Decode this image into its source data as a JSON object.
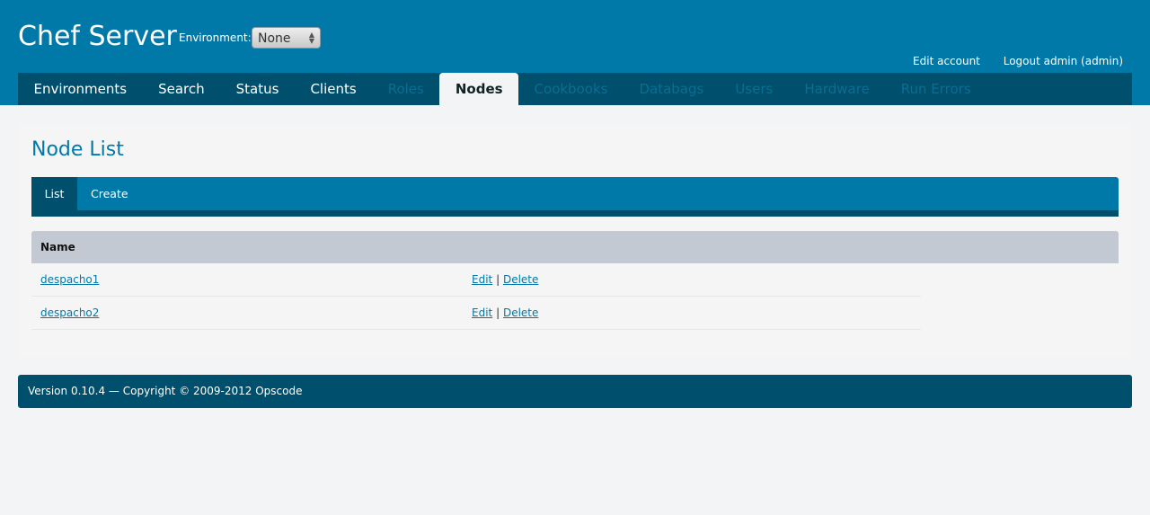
{
  "header": {
    "title": "Chef Server",
    "environment_label": "Environment:",
    "environment_value": "None",
    "edit_account": "Edit account",
    "logout": "Logout admin (admin)"
  },
  "nav": {
    "items": [
      {
        "label": "Environments",
        "state": "normal"
      },
      {
        "label": "Search",
        "state": "normal"
      },
      {
        "label": "Status",
        "state": "normal"
      },
      {
        "label": "Clients",
        "state": "normal"
      },
      {
        "label": "Roles",
        "state": "dim"
      },
      {
        "label": "Nodes",
        "state": "active"
      },
      {
        "label": "Cookbooks",
        "state": "dim"
      },
      {
        "label": "Databags",
        "state": "dim"
      },
      {
        "label": "Users",
        "state": "dim"
      },
      {
        "label": "Hardware",
        "state": "dim"
      },
      {
        "label": "Run Errors",
        "state": "dim"
      }
    ]
  },
  "main": {
    "page_title": "Node List",
    "tabs": [
      {
        "label": "List"
      },
      {
        "label": "Create"
      }
    ],
    "table": {
      "column_name": "Name",
      "rows": [
        {
          "name": "despacho1",
          "edit": "Edit",
          "separator": "|",
          "delete": "Delete"
        },
        {
          "name": "despacho2",
          "edit": "Edit",
          "separator": "|",
          "delete": "Delete"
        }
      ]
    }
  },
  "footer": {
    "text": "Version 0.10.4 — Copyright © 2009-2012 Opscode"
  },
  "colors": {
    "header_bg": "#0079a8",
    "nav_bg": "#004f6c",
    "accent": "#0079a8"
  }
}
